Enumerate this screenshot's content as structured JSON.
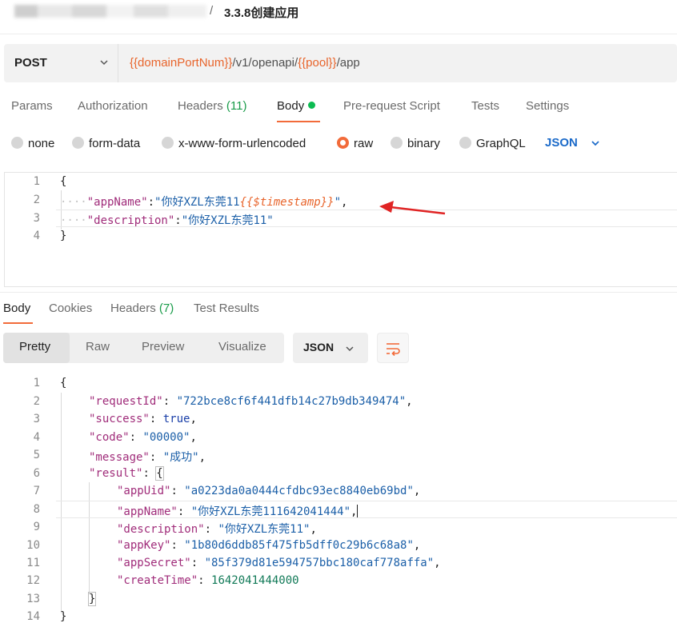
{
  "breadcrumb": {
    "separator": "/",
    "title": "3.3.8创建应用"
  },
  "request": {
    "method": "POST",
    "url_parts": [
      {
        "text": "{{domainPortNum}}",
        "is_var": true
      },
      {
        "text": "/v1/openapi/",
        "is_var": false
      },
      {
        "text": "{{pool}}",
        "is_var": true
      },
      {
        "text": "/app",
        "is_var": false
      }
    ],
    "tabs": {
      "params": "Params",
      "authorization": "Authorization",
      "headers": "Headers",
      "headers_count": "(11)",
      "body": "Body",
      "prerequest": "Pre-request Script",
      "tests": "Tests",
      "settings": "Settings"
    },
    "body_types": {
      "none": "none",
      "form_data": "form-data",
      "urlencoded": "x-www-form-urlencoded",
      "raw": "raw",
      "binary": "binary",
      "graphql": "GraphQL",
      "selected": "raw"
    },
    "format": "JSON",
    "editor": {
      "line_numbers": [
        "1",
        "2",
        "3",
        "4"
      ],
      "open_brace": "{",
      "close_brace": "}",
      "dots": "····",
      "app_name_key": "\"appName\"",
      "colon": ":",
      "app_name_value_prefix": "\"你好XZL东莞11",
      "app_name_template": "{{$timestamp}}",
      "app_name_value_suffix": "\"",
      "comma": ",",
      "description_key": "\"description\"",
      "description_value": "\"你好XZL东莞11\""
    }
  },
  "response": {
    "tabs": {
      "body": "Body",
      "cookies": "Cookies",
      "headers": "Headers",
      "headers_count": "(7)",
      "test_results": "Test Results"
    },
    "view_modes": {
      "pretty": "Pretty",
      "raw": "Raw",
      "preview": "Preview",
      "visualize": "Visualize",
      "selected": "Pretty"
    },
    "format": "JSON",
    "line_numbers": [
      "1",
      "2",
      "3",
      "4",
      "5",
      "6",
      "7",
      "8",
      "9",
      "10",
      "11",
      "12",
      "13",
      "14"
    ],
    "open_brace": "{",
    "close_brace": "}",
    "inner_close": "}",
    "fields": [
      {
        "key": "\"requestId\"",
        "value": "\"722bce8cf6f441dfb14c27b9db349474\"",
        "type": "string"
      },
      {
        "key": "\"success\"",
        "value": "true",
        "type": "keyword"
      },
      {
        "key": "\"code\"",
        "value": "\"00000\"",
        "type": "string"
      },
      {
        "key": "\"message\"",
        "value": "\"成功\"",
        "type": "string"
      }
    ],
    "result_key": "\"result\"",
    "result_fields": [
      {
        "key": "\"appUid\"",
        "value": "\"a0223da0a0444cfdbc93ec8840eb69bd\"",
        "type": "string"
      },
      {
        "key": "\"appName\"",
        "value": "\"你好XZL东莞111642041444\"",
        "type": "string"
      },
      {
        "key": "\"description\"",
        "value": "\"你好XZL东莞11\"",
        "type": "string"
      },
      {
        "key": "\"appKey\"",
        "value": "\"1b80d6ddb85f475fb5dff0c29b6c68a8\"",
        "type": "string"
      },
      {
        "key": "\"appSecret\"",
        "value": "\"85f379d81e594757bbc180caf778affa\"",
        "type": "string"
      },
      {
        "key": "\"createTime\"",
        "value": "1642041444000",
        "type": "number"
      }
    ]
  },
  "colors": {
    "accent": "#f26b3a",
    "variable": "#e8642b",
    "link_blue": "#1b6ac9",
    "active_dot": "#0cbb52",
    "annotation_arrow": "#e02424"
  }
}
